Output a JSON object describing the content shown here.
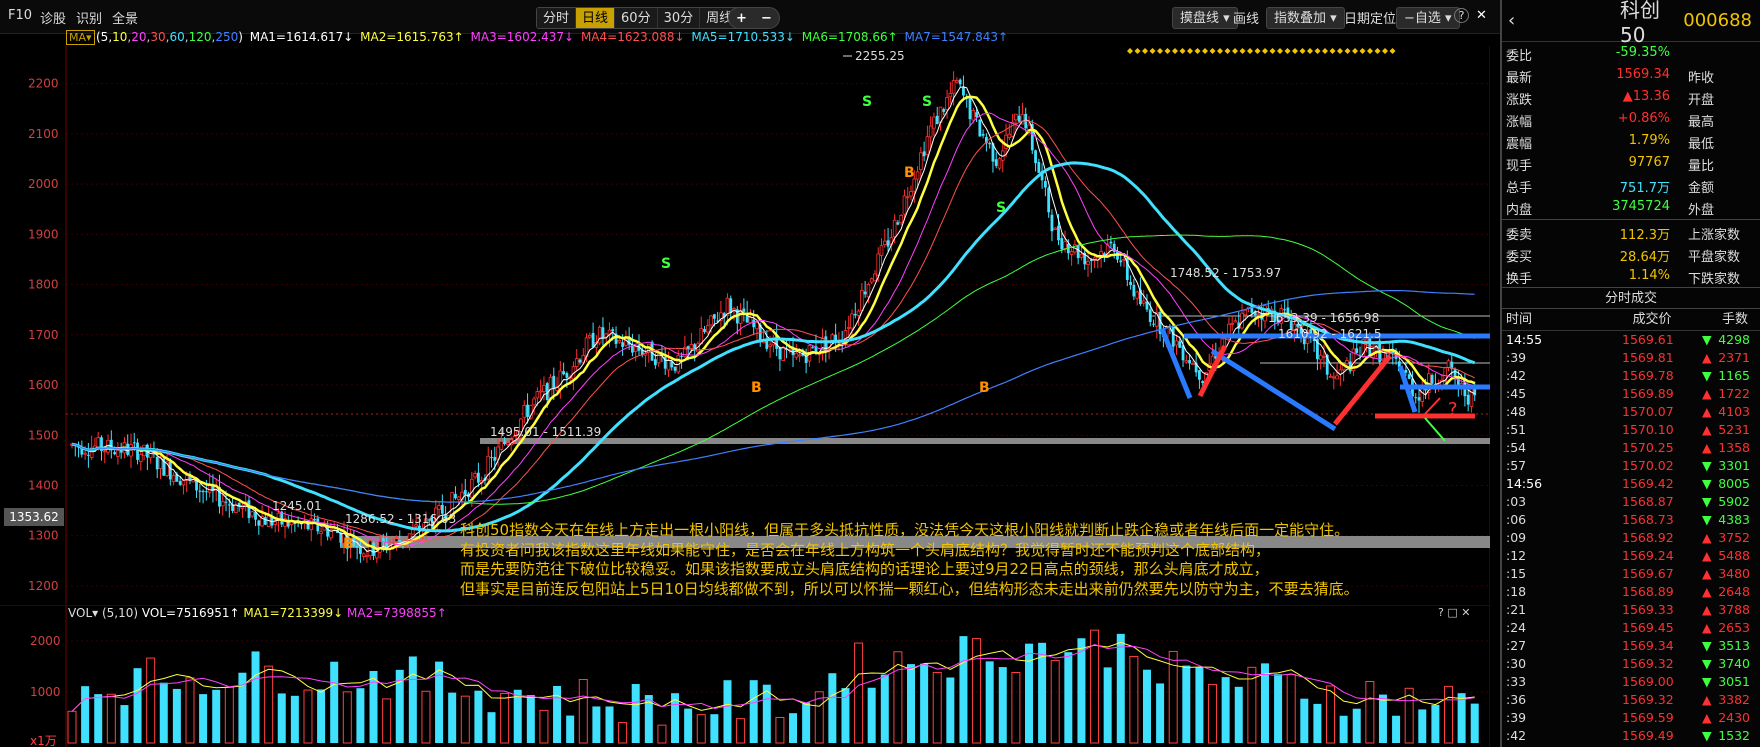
{
  "toolbar": {
    "f10": "F10",
    "diagnose": "诊股",
    "identify": "识别",
    "panorama": "全景",
    "periods": [
      "分时",
      "日线",
      "60分",
      "30分",
      "周线 ▾"
    ],
    "active_period": "日线",
    "plus": "+",
    "minus": "−",
    "candle_type": "摸盘线 ▾",
    "draw": "画线",
    "overlay": "指数叠加 ▾",
    "date_locate": "日期定位",
    "self_select": "−自选 ▾",
    "help": "?",
    "close": "✕"
  },
  "ma_legend": {
    "tag": "MA▾",
    "params_prefix": "(5,",
    "params": [
      "10",
      "20",
      "30",
      "60",
      "120",
      "250"
    ],
    "params_suffix": ")",
    "items": [
      {
        "text": "MA1=1614.617↓",
        "color": "#ffffff"
      },
      {
        "text": "MA2=1615.763↑",
        "color": "#ffff40"
      },
      {
        "text": "MA3=1602.437↓",
        "color": "#ff40ff"
      },
      {
        "text": "MA4=1623.088↓",
        "color": "#ff5050"
      },
      {
        "text": "MA5=1710.533↓",
        "color": "#40e0ff"
      },
      {
        "text": "MA6=1708.66↑",
        "color": "#40ff40"
      },
      {
        "text": "MA7=1547.843↑",
        "color": "#4080ff"
      }
    ]
  },
  "price_axis": [
    "2200",
    "2100",
    "2000",
    "1900",
    "1800",
    "1700",
    "1600",
    "1500",
    "1400",
    "1300",
    "1200"
  ],
  "price_tag": "1353.62",
  "chart_labels": {
    "high": "2255.25",
    "low": "1245.01",
    "zone1": "1495.01 - 1511.39",
    "zone2": "1286.52 - 1316.63",
    "zone3": "1748.52 - 1753.97",
    "zone4": "1653.39 - 1656.98",
    "zone5": "1610.92 - 1621.5",
    "question": "?"
  },
  "annotation": [
    "科创50指数今天在年线上方走出一根小阳线，但属于多头抵抗性质，没法凭今天这根小阳线就判断止跌企稳或者年线后面一定能守住。",
    "有投资者问我该指数这里年线如果能守住，是否会在年线上方构筑一个头肩底结构？我觉得暂时还不能预判这个底部结构，",
    "而是先要防范往下破位比较稳妥。如果该指数要成立头肩底结构的话理论上要过9月22日高点的颈线，那么头肩底才成立，",
    "但事实是目前连反包阳站上5日10日均线都做不到，所以可以怀揣一颗红心，但结构形态未走出来前仍然要先以防守为主，不要去猜底。"
  ],
  "vol_legend": {
    "tag": "VOL▾",
    "params": "(5,10)",
    "items": [
      {
        "text": "VOL=7516951↑",
        "color": "#ffffff"
      },
      {
        "text": "MA1=7213399↓",
        "color": "#ffff40"
      },
      {
        "text": "MA2=7398855↑",
        "color": "#ff40ff"
      }
    ],
    "window_btns": "? □ ✕"
  },
  "vol_axis": [
    "2000",
    "1000"
  ],
  "vol_unit": "x1万",
  "quote": {
    "name": "科创50",
    "code": "000688",
    "rows": [
      {
        "lbl": "委比",
        "val": "-59.35%",
        "color": "#40ff40",
        "lbl2": ""
      },
      {
        "lbl": "最新",
        "val": "1569.34",
        "color": "#ff3030",
        "lbl2": "昨收"
      },
      {
        "lbl": "涨跌",
        "val": "▲13.36",
        "color": "#ff3030",
        "lbl2": "开盘"
      },
      {
        "lbl": "涨幅",
        "val": "+0.86%",
        "color": "#ff3030",
        "lbl2": "最高"
      },
      {
        "lbl": "震幅",
        "val": "1.79%",
        "color": "#f0c400",
        "lbl2": "最低"
      },
      {
        "lbl": "现手",
        "val": "97767",
        "color": "#f0c400",
        "lbl2": "量比"
      },
      {
        "lbl": "总手",
        "val": "751.7万",
        "color": "#40e0ff",
        "lbl2": "金额"
      },
      {
        "lbl": "内盘",
        "val": "3745724",
        "color": "#40ff40",
        "lbl2": "外盘"
      }
    ],
    "rows2": [
      {
        "lbl": "委卖",
        "val": "112.3万",
        "color": "#f0c400",
        "lbl2": "上涨家数"
      },
      {
        "lbl": "委买",
        "val": "28.64万",
        "color": "#f0c400",
        "lbl2": "平盘家数"
      },
      {
        "lbl": "换手",
        "val": "1.14%",
        "color": "#f0c400",
        "lbl2": "下跌家数"
      }
    ]
  },
  "ticks": {
    "title": "分时成交",
    "headers": [
      "时间",
      "成交价",
      "手数"
    ],
    "rows": [
      {
        "t": "14:55",
        "p": "1569.61",
        "a": "▼",
        "v": "4298",
        "major": true
      },
      {
        "t": ":39",
        "p": "1569.81",
        "a": "▲",
        "v": "2371"
      },
      {
        "t": ":42",
        "p": "1569.78",
        "a": "▼",
        "v": "1165"
      },
      {
        "t": ":45",
        "p": "1569.89",
        "a": "▲",
        "v": "1722"
      },
      {
        "t": ":48",
        "p": "1570.07",
        "a": "▲",
        "v": "4103"
      },
      {
        "t": ":51",
        "p": "1570.10",
        "a": "▲",
        "v": "5231"
      },
      {
        "t": ":54",
        "p": "1570.25",
        "a": "▲",
        "v": "1358"
      },
      {
        "t": ":57",
        "p": "1570.02",
        "a": "▼",
        "v": "3301"
      },
      {
        "t": "14:56",
        "p": "1569.42",
        "a": "▼",
        "v": "8005",
        "major": true
      },
      {
        "t": ":03",
        "p": "1568.87",
        "a": "▼",
        "v": "5902"
      },
      {
        "t": ":06",
        "p": "1568.73",
        "a": "▼",
        "v": "4383"
      },
      {
        "t": ":09",
        "p": "1568.92",
        "a": "▲",
        "v": "3752"
      },
      {
        "t": ":12",
        "p": "1569.24",
        "a": "▲",
        "v": "5488"
      },
      {
        "t": ":15",
        "p": "1569.67",
        "a": "▲",
        "v": "3480"
      },
      {
        "t": ":18",
        "p": "1568.89",
        "a": "▲",
        "v": "2648"
      },
      {
        "t": ":21",
        "p": "1569.33",
        "a": "▲",
        "v": "3788"
      },
      {
        "t": ":24",
        "p": "1569.45",
        "a": "▲",
        "v": "2653"
      },
      {
        "t": ":27",
        "p": "1569.34",
        "a": "▼",
        "v": "3513"
      },
      {
        "t": ":30",
        "p": "1569.32",
        "a": "▼",
        "v": "3740"
      },
      {
        "t": ":33",
        "p": "1569.00",
        "a": "▼",
        "v": "3051"
      },
      {
        "t": ":36",
        "p": "1569.32",
        "a": "▲",
        "v": "3382"
      },
      {
        "t": ":39",
        "p": "1569.59",
        "a": "▲",
        "v": "2430"
      },
      {
        "t": ":42",
        "p": "1569.49",
        "a": "▼",
        "v": "1532"
      }
    ]
  },
  "colors": {
    "up": "#ff3030",
    "down": "#40e0ff",
    "accent": "#f0c400",
    "grid": "#3a0000"
  }
}
